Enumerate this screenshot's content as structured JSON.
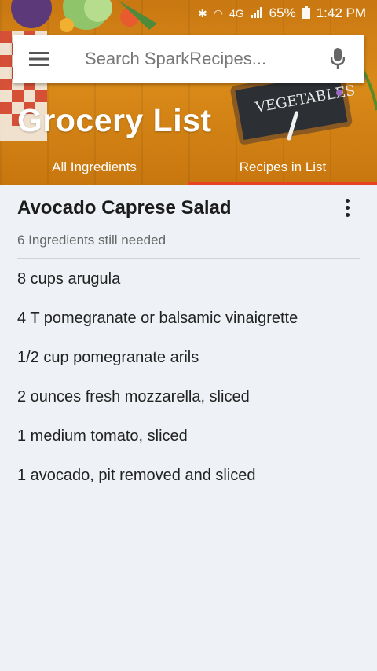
{
  "status_bar": {
    "battery": "65%",
    "time": "1:42 PM",
    "network": "4G"
  },
  "search": {
    "placeholder": "Search SparkRecipes..."
  },
  "page": {
    "title": "Grocery List"
  },
  "tabs": [
    {
      "label": "All Ingredients",
      "active": false
    },
    {
      "label": "Recipes in List",
      "active": true
    }
  ],
  "chalkboard_text": "VEGETABLES",
  "recipe": {
    "title": "Avocado Caprese Salad",
    "status": "6 Ingredients still needed",
    "ingredients": [
      "8 cups arugula",
      "4 T pomegranate or balsamic vinaigrette",
      "1/2 cup pomegranate arils",
      "2 ounces fresh mozzarella, sliced",
      "1 medium tomato, sliced",
      "1 avocado, pit removed and sliced"
    ]
  },
  "colors": {
    "header_wood": "#d98a18",
    "tab_indicator": "#e84424",
    "background": "#eef1f5"
  }
}
